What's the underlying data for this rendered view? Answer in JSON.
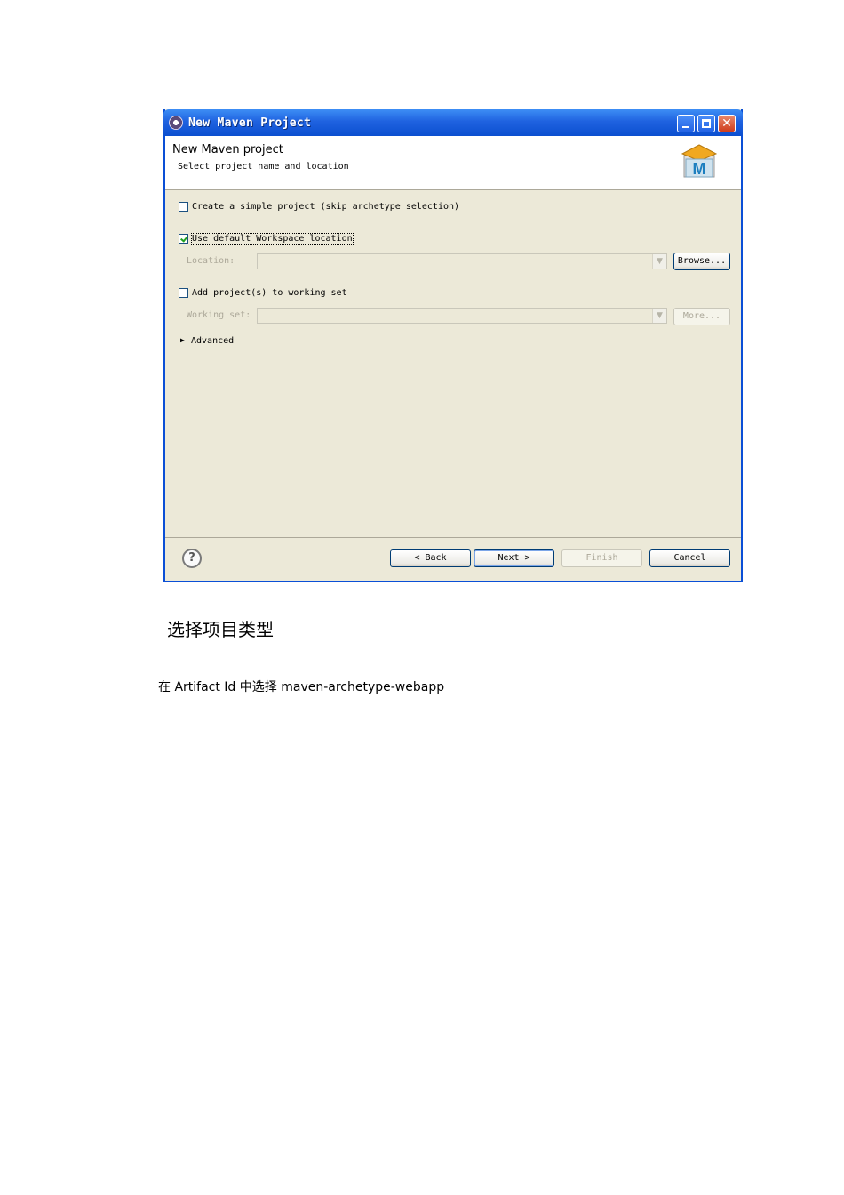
{
  "window": {
    "title": "New Maven Project",
    "banner": {
      "title": "New Maven project",
      "subtitle": "Select project name and location",
      "logo_letter": "M"
    }
  },
  "form": {
    "simple_project": {
      "label": "Create a simple project (skip archetype selection)",
      "checked": false
    },
    "default_workspace": {
      "label": "Use default Workspace location",
      "checked": true
    },
    "location": {
      "label": "Location:",
      "value": "",
      "enabled": false
    },
    "browse_label": "Browse...",
    "add_working_set": {
      "label": "Add project(s) to working set",
      "checked": false
    },
    "working_set": {
      "label": "Working set:",
      "value": "",
      "enabled": false
    },
    "more_label": "More...",
    "advanced_label": "Advanced"
  },
  "buttons": {
    "back": "< Back",
    "next": "Next >",
    "finish": "Finish",
    "cancel": "Cancel"
  },
  "help_glyph": "?",
  "document": {
    "heading": "选择项目类型",
    "note": "在 Artifact Id 中选择 maven-archetype-webapp"
  }
}
